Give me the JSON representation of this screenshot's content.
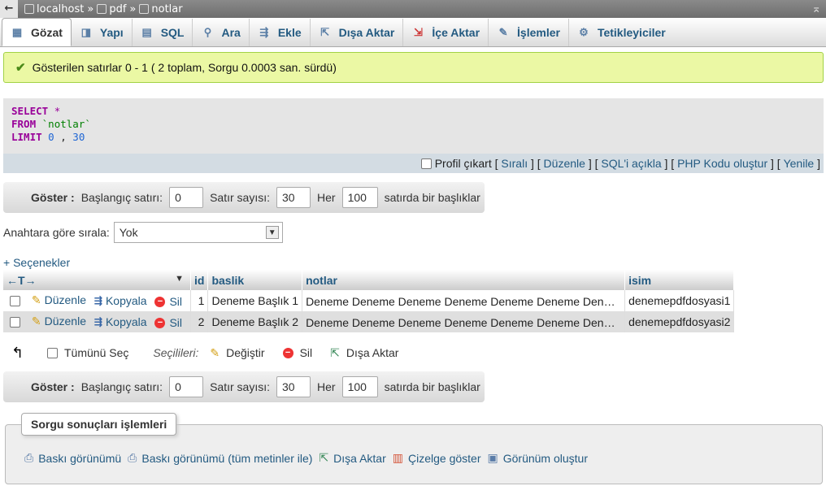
{
  "breadcrumb": {
    "back": "←",
    "server": "localhost",
    "database": "pdf",
    "table": "notlar",
    "separator": "»",
    "collapse": "⌅"
  },
  "tabs": [
    {
      "label": "Gözat",
      "icon": "browse-icon"
    },
    {
      "label": "Yapı",
      "icon": "structure-icon"
    },
    {
      "label": "SQL",
      "icon": "sql-icon"
    },
    {
      "label": "Ara",
      "icon": "search-icon"
    },
    {
      "label": "Ekle",
      "icon": "insert-icon"
    },
    {
      "label": "Dışa Aktar",
      "icon": "export-icon"
    },
    {
      "label": "İçe Aktar",
      "icon": "import-icon"
    },
    {
      "label": "İşlemler",
      "icon": "wrench-icon"
    },
    {
      "label": "Tetikleyiciler",
      "icon": "triggers-icon"
    }
  ],
  "message": "Gösterilen satırlar 0 - 1 ( 2 toplam, Sorgu 0.0003 san. sürdü)",
  "sql": {
    "select": "SELECT",
    "star": "*",
    "from": "FROM",
    "table": "`notlar`",
    "limit": "LIMIT",
    "offset": "0",
    "comma": ",",
    "count": "30"
  },
  "sql_links": {
    "profile": "Profil çıkart",
    "inline": "Sıralı",
    "edit": "Düzenle",
    "explain": "SQL'i açıkla",
    "php": "PHP Kodu oluştur",
    "refresh": "Yenile",
    "open": "[",
    "close": "]",
    "between": "] ["
  },
  "nav": {
    "show_label": "Göster :",
    "start_label": "Başlangıç satırı:",
    "start_value": "0",
    "rows_label": "Satır sayısı:",
    "rows_value": "30",
    "every_label": "Her",
    "every_value": "100",
    "headers_label": "satırda bir başlıklar"
  },
  "sort": {
    "label": "Anahtara göre sırala:",
    "value": "Yok"
  },
  "options_link": "+ Seçenekler",
  "table": {
    "arrows": "←T→",
    "sort_arrow": "▼",
    "columns": [
      "id",
      "baslik",
      "notlar",
      "isim"
    ],
    "actions": {
      "edit": "Düzenle",
      "copy": "Kopyala",
      "delete": "Sil"
    },
    "rows": [
      {
        "id": "1",
        "baslik": "Deneme Başlık 1",
        "notlar": "Deneme Deneme Deneme Deneme Deneme Deneme Deneme Deneme Deneme",
        "isim": "denemepdfdosyasi1"
      },
      {
        "id": "2",
        "baslik": "Deneme Başlık 2",
        "notlar": "Deneme Deneme Deneme Deneme Deneme Deneme Deneme Deneme Deneme",
        "isim": "denemepdfdosyasi2"
      }
    ]
  },
  "bulk": {
    "check_all": "Tümünü Seç",
    "with_selected": "Seçilileri:",
    "change": "Değiştir",
    "delete": "Sil",
    "export": "Dışa Aktar"
  },
  "query_ops": {
    "legend": "Sorgu sonuçları işlemleri",
    "print": "Baskı görünümü",
    "print_full": "Baskı görünümü (tüm metinler ile)",
    "export": "Dışa Aktar",
    "chart": "Çizelge göster",
    "view": "Görünüm oluştur"
  }
}
